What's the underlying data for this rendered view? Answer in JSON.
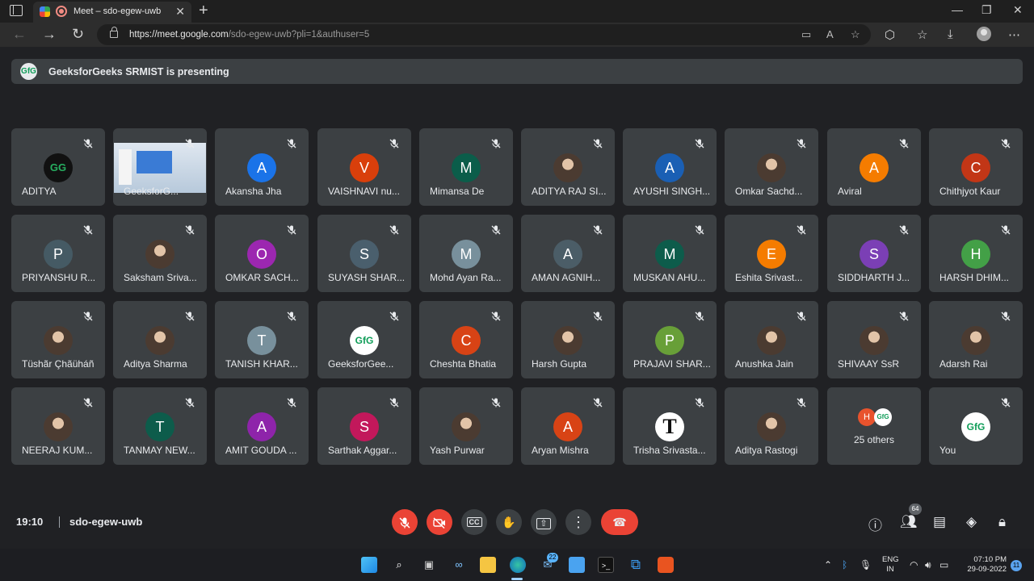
{
  "browser": {
    "tab_title": "Meet – sdo-egew-uwb",
    "tab_close": "✕",
    "new_tab": "+",
    "url_host": "https://meet.google.com",
    "url_path": "/sdo-egew-uwb?pli=1&authuser=5",
    "window_controls": [
      "—",
      "❐",
      "✕"
    ]
  },
  "presenting": {
    "icon_text": "GfG",
    "text": "GeeksforGeeks SRMIST is presenting"
  },
  "participants": [
    {
      "name": "ADITYA",
      "avatar": "gfg-dark",
      "initial": "GG",
      "color": "#111111"
    },
    {
      "name": "GeeksforG...",
      "avatar": "screen",
      "initial": "",
      "color": ""
    },
    {
      "name": "Akansha Jha",
      "avatar": "letter",
      "initial": "A",
      "color": "#1a73e8"
    },
    {
      "name": "VAISHNAVI nu...",
      "avatar": "letter",
      "initial": "V",
      "color": "#d93f0b"
    },
    {
      "name": "Mimansa De",
      "avatar": "letter",
      "initial": "M",
      "color": "#0b5d4a"
    },
    {
      "name": "ADITYA RAJ SI...",
      "avatar": "photo",
      "initial": "",
      "color": ""
    },
    {
      "name": "AYUSHI SINGH...",
      "avatar": "letter",
      "initial": "A",
      "color": "#1a5fb4"
    },
    {
      "name": "Omkar Sachd...",
      "avatar": "photo",
      "initial": "",
      "color": ""
    },
    {
      "name": "Aviral",
      "avatar": "letter",
      "initial": "A",
      "color": "#f57c00"
    },
    {
      "name": "Chithjyot Kaur",
      "avatar": "letter",
      "initial": "C",
      "color": "#c23616"
    },
    {
      "name": "PRIYANSHU R...",
      "avatar": "letter",
      "initial": "P",
      "color": "#455a64"
    },
    {
      "name": "Saksham Sriva...",
      "avatar": "photo",
      "initial": "",
      "color": ""
    },
    {
      "name": "OMKAR SACH...",
      "avatar": "letter",
      "initial": "O",
      "color": "#9c27b0"
    },
    {
      "name": "SUYASH SHAR...",
      "avatar": "letter",
      "initial": "S",
      "color": "#4a5f6d"
    },
    {
      "name": "Mohd Ayan Ra...",
      "avatar": "letter",
      "initial": "M",
      "color": "#78909c"
    },
    {
      "name": "AMAN AGNIH...",
      "avatar": "letter",
      "initial": "A",
      "color": "#4b5d67"
    },
    {
      "name": "MUSKAN AHU...",
      "avatar": "letter",
      "initial": "M",
      "color": "#0d5c4b"
    },
    {
      "name": "Eshita Srivast...",
      "avatar": "letter",
      "initial": "E",
      "color": "#f57c00"
    },
    {
      "name": "SIDDHARTH J...",
      "avatar": "letter",
      "initial": "S",
      "color": "#7b3fb5"
    },
    {
      "name": "HARSH DHIM...",
      "avatar": "letter",
      "initial": "H",
      "color": "#43a047"
    },
    {
      "name": "Tüshãr Çhãüháñ",
      "avatar": "photo",
      "initial": "",
      "color": ""
    },
    {
      "name": "Aditya Sharma",
      "avatar": "photo",
      "initial": "",
      "color": ""
    },
    {
      "name": "TANISH KHAR...",
      "avatar": "letter",
      "initial": "T",
      "color": "#78909c"
    },
    {
      "name": "GeeksforGee...",
      "avatar": "gfg",
      "initial": "GfG",
      "color": "#ffffff"
    },
    {
      "name": "Cheshta Bhatia",
      "avatar": "letter",
      "initial": "C",
      "color": "#d84315"
    },
    {
      "name": "Harsh Gupta",
      "avatar": "photo",
      "initial": "",
      "color": ""
    },
    {
      "name": "PRAJAVI SHAR...",
      "avatar": "letter",
      "initial": "P",
      "color": "#689f38"
    },
    {
      "name": "Anushka Jain",
      "avatar": "photo",
      "initial": "",
      "color": ""
    },
    {
      "name": "SHIVAAY SsR",
      "avatar": "photo",
      "initial": "",
      "color": ""
    },
    {
      "name": "Adarsh Rai",
      "avatar": "photo",
      "initial": "",
      "color": ""
    },
    {
      "name": "NEERAJ KUM...",
      "avatar": "photo",
      "initial": "",
      "color": ""
    },
    {
      "name": "TANMAY NEW...",
      "avatar": "letter",
      "initial": "T",
      "color": "#0d5c4b"
    },
    {
      "name": "AMIT GOUDA ...",
      "avatar": "letter",
      "initial": "A",
      "color": "#8e24aa"
    },
    {
      "name": "Sarthak Aggar...",
      "avatar": "letter",
      "initial": "S",
      "color": "#c2185b"
    },
    {
      "name": "Yash Purwar",
      "avatar": "photo",
      "initial": "",
      "color": ""
    },
    {
      "name": "Aryan Mishra",
      "avatar": "letter",
      "initial": "A",
      "color": "#d84315"
    },
    {
      "name": "Trisha Srivasta...",
      "avatar": "letter-t",
      "initial": "T",
      "color": "#ffffff"
    },
    {
      "name": "Aditya Rastogi",
      "avatar": "photo",
      "initial": "",
      "color": ""
    },
    {
      "name": "25 others",
      "avatar": "others",
      "initial": "H",
      "color": "#e8532d"
    },
    {
      "name": "You",
      "avatar": "gfg",
      "initial": "GfG",
      "color": "#ffffff"
    }
  ],
  "meeting": {
    "time": "19:10",
    "code": "sdo-egew-uwb",
    "participant_count": "64"
  },
  "controls": {
    "mic_icon": "mic-off-icon",
    "camera_icon": "camera-off-icon",
    "captions_label": "CC",
    "hand_glyph": "✋",
    "present_glyph": "⇧",
    "more_glyph": "⋮",
    "hangup_glyph": "☎"
  },
  "taskbar": {
    "mail_badge": "22",
    "lang_top": "ENG",
    "lang_bottom": "IN",
    "time": "07:10 PM",
    "date": "29-09-2022",
    "notification_count": "11"
  }
}
